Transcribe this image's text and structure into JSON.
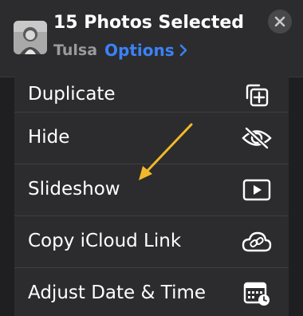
{
  "header": {
    "title": "15 Photos Selected",
    "location": "Tulsa",
    "options_label": "Options",
    "thumbnail_icon": "photo-thumbnail"
  },
  "close_icon": "close-icon",
  "menu": {
    "items": [
      {
        "label": "Duplicate",
        "icon": "duplicate-icon"
      },
      {
        "label": "Hide",
        "icon": "eye-slash-icon"
      },
      {
        "label": "Slideshow",
        "icon": "play-icon"
      },
      {
        "label": "Copy iCloud Link",
        "icon": "cloud-link-icon"
      },
      {
        "label": "Adjust Date & Time",
        "icon": "calendar-clock-icon"
      }
    ]
  },
  "colors": {
    "accent": "#3b82f6",
    "annotation_arrow": "#f2b92a"
  }
}
